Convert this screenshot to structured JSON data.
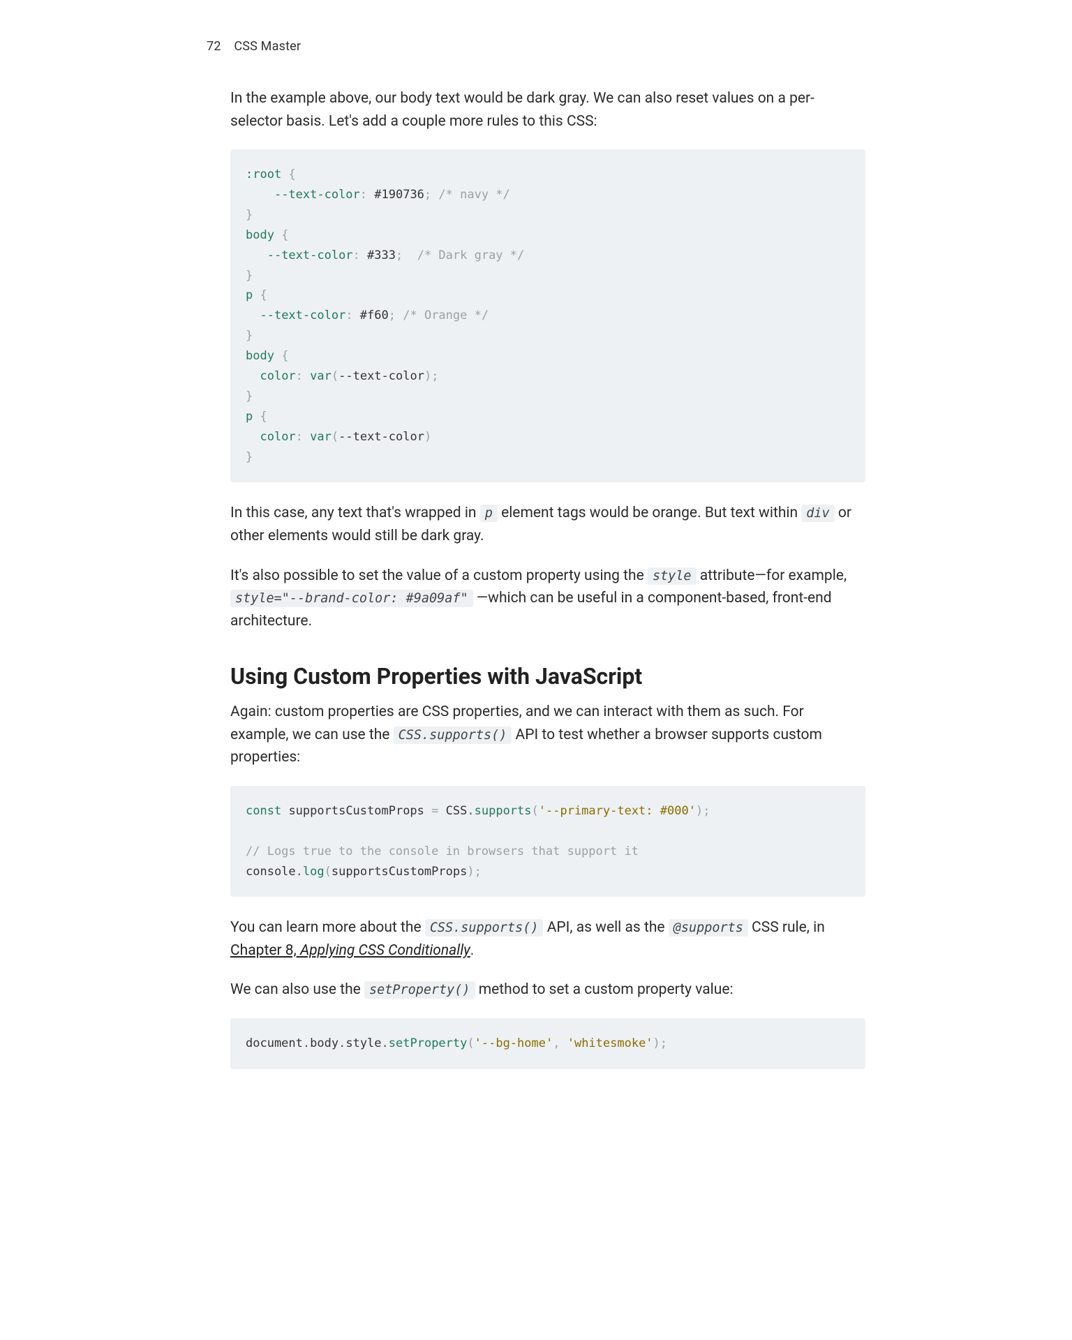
{
  "header": {
    "page_number": "72",
    "book_title": "CSS Master"
  },
  "para1_a": "In the example above, our body text would be dark gray. We can also reset values on a per-selector basis. Let's add a couple more rules to this CSS:",
  "code1": {
    "l1_sel": ":root",
    "l1_punc": " {",
    "l2_indent": "    ",
    "l2_prop": "--text-color",
    "l2_colon": ": ",
    "l2_val": "#190736",
    "l2_semi": ";",
    "l2_sp": " ",
    "l2_cmt": "/* navy */",
    "l3_punc": "}",
    "l4_sel": "body",
    "l4_punc": " {",
    "l5_indent": "   ",
    "l5_prop": "--text-color",
    "l5_colon": ": ",
    "l5_val": "#333",
    "l5_semi": ";",
    "l5_sp": "  ",
    "l5_cmt": "/* Dark gray */",
    "l6_punc": "}",
    "l7_sel": "p",
    "l7_punc": " {",
    "l8_indent": "  ",
    "l8_prop": "--text-color",
    "l8_colon": ": ",
    "l8_val": "#f60",
    "l8_semi": ";",
    "l8_sp": " ",
    "l8_cmt": "/* Orange */",
    "l9_punc": "}",
    "l10_sel": "body",
    "l10_punc": " {",
    "l11_indent": "  ",
    "l11_prop": "color",
    "l11_colon": ": ",
    "l11_fn": "var",
    "l11_op": "(",
    "l11_arg": "--text-color",
    "l11_cp": ")",
    "l11_semi": ";",
    "l12_punc": "}",
    "l13_sel": "p",
    "l13_punc": " {",
    "l14_indent": "  ",
    "l14_prop": "color",
    "l14_colon": ": ",
    "l14_fn": "var",
    "l14_op": "(",
    "l14_arg": "--text-color",
    "l14_cp": ")",
    "l15_punc": "}"
  },
  "para2_a": "In this case, any text that's wrapped in ",
  "para2_code1": "p",
  "para2_b": " element tags would be orange. But text within ",
  "para2_code2": "div",
  "para2_c": " or other elements would still be dark gray.",
  "para3_a": "It's also possible to set the value of a custom property using the ",
  "para3_code1": "style",
  "para3_b": " attribute—for example, ",
  "para3_code2": "style=\"--brand-color: #9a09af\"",
  "para3_c": " —which can be useful in a component-based, front-end architecture.",
  "heading1": "Using Custom Properties with JavaScript",
  "para4_a": "Again: custom properties are CSS properties, and we can interact with them as such. For example, we can use the ",
  "para4_code1": "CSS.supports()",
  "para4_b": " API to test whether a browser supports custom properties:",
  "code2": {
    "l1_kw": "const",
    "l1_sp1": " ",
    "l1_name": "supportsCustomProps",
    "l1_sp2": " ",
    "l1_eq": "=",
    "l1_sp3": " ",
    "l1_obj": "CSS",
    "l1_dot": ".",
    "l1_fn": "supports",
    "l1_op": "(",
    "l1_str": "'--primary-text: #000'",
    "l1_cp": ")",
    "l1_semi": ";",
    "l3_cmt": "// Logs true to the console in browsers that support it",
    "l4_obj": "console",
    "l4_dot": ".",
    "l4_fn": "log",
    "l4_op": "(",
    "l4_arg": "supportsCustomProps",
    "l4_cp": ")",
    "l4_semi": ";"
  },
  "para5_a": "You can learn more about the ",
  "para5_code1": "CSS.supports()",
  "para5_b": " API, as well as the ",
  "para5_code2": "@supports",
  "para5_c": " CSS rule, in ",
  "para5_link": "Chapter 8, ",
  "para5_link_em": "Applying CSS Conditionally",
  "para5_d": ".",
  "para6_a": "We can also use the ",
  "para6_code1": "setProperty()",
  "para6_b": " method to set a custom property value:",
  "code3": {
    "l1_a": "document",
    "l1_d1": ".",
    "l1_b": "body",
    "l1_d2": ".",
    "l1_c": "style",
    "l1_d3": ".",
    "l1_fn": "setProperty",
    "l1_op": "(",
    "l1_s1": "'--bg-home'",
    "l1_cm": ",",
    "l1_sp": " ",
    "l1_s2": "'whitesmoke'",
    "l1_cp": ")",
    "l1_semi": ";"
  }
}
